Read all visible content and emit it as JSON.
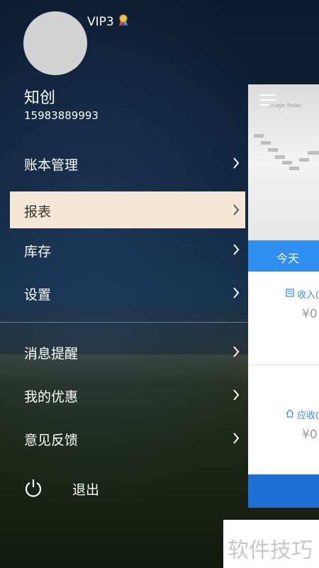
{
  "user": {
    "vip_level": "VIP3",
    "name": "知创",
    "phone": "15983889993"
  },
  "menu": {
    "items": [
      {
        "label": "账本管理"
      },
      {
        "label": "报表"
      },
      {
        "label": "库存"
      },
      {
        "label": "设置"
      },
      {
        "label": "消息提醒"
      },
      {
        "label": "我的优惠"
      },
      {
        "label": "意见反馈"
      }
    ],
    "active_index": 1,
    "logout_label": "退出"
  },
  "content": {
    "banner_text": "Image Today",
    "today_tab": "今天",
    "income_label": "收入(",
    "income_value": "¥0",
    "receivable_label": "应收(",
    "receivable_value": "¥0"
  },
  "watermark": "软件技巧",
  "colors": {
    "active_item_bg": "#f5e6d6",
    "accent_blue": "#2f8ff0",
    "bottom_bar_blue": "#1e6fd6"
  }
}
